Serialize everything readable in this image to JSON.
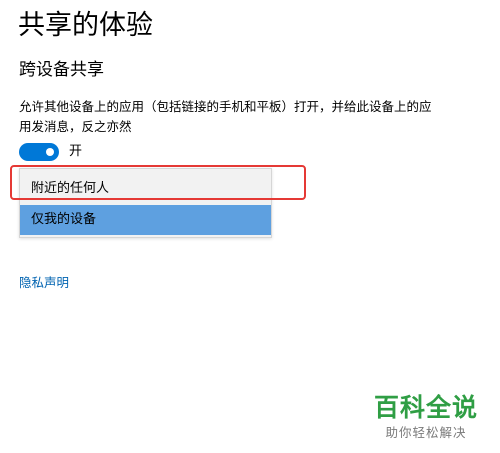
{
  "page": {
    "title": "共享的体验",
    "section_title": "跨设备共享",
    "description": "允许其他设备上的应用（包括链接的手机和平板）打开，并给此设备上的应用发消息，反之亦然"
  },
  "toggle": {
    "state": "on",
    "label": "开",
    "accent_color": "#0078d7"
  },
  "dropdown": {
    "options": [
      {
        "label": "附近的任何人",
        "selected": false
      },
      {
        "label": "仅我的设备",
        "selected": true
      }
    ],
    "selected_color": "#5ea0e0",
    "highlight_color": "#e53935"
  },
  "links": {
    "privacy": "隐私声明"
  },
  "watermark": {
    "main": "百科全说",
    "sub": "助你轻松解决",
    "color": "#2f9e44"
  }
}
